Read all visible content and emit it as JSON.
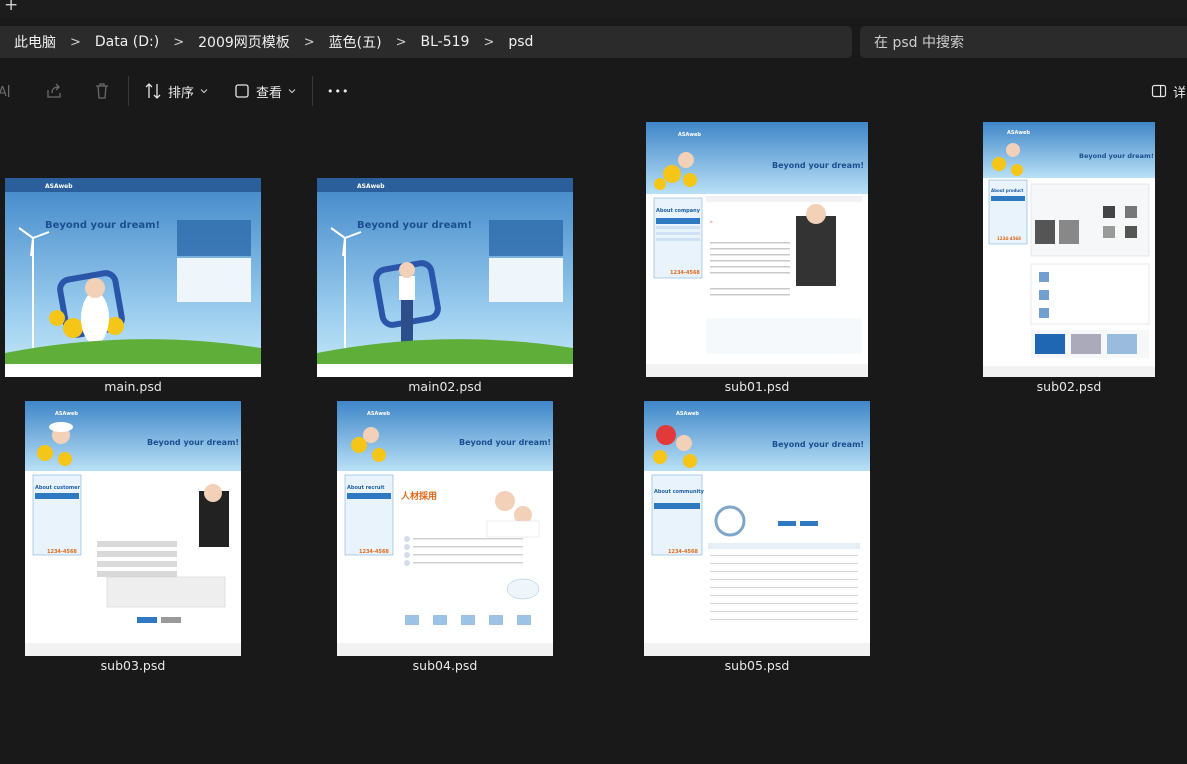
{
  "titlebar": {
    "new_tab_label": "+"
  },
  "breadcrumb": [
    "此电脑",
    "Data (D:)",
    "2009网页模板",
    "蓝色(五)",
    "BL-519",
    "psd"
  ],
  "breadcrumb_separator": ">",
  "search": {
    "placeholder": "在 psd 中搜索"
  },
  "toolbar": {
    "sort_label": "排序",
    "view_label": "查看",
    "more_label": "•••",
    "details_label": "详"
  },
  "files": [
    {
      "name": "main.psd",
      "kind": "main",
      "slogan": "Beyond your dream!"
    },
    {
      "name": "main02.psd",
      "kind": "main",
      "slogan": "Beyond your dream!"
    },
    {
      "name": "sub01.psd",
      "kind": "sub",
      "slogan": "Beyond your dream!",
      "section": "About company"
    },
    {
      "name": "sub02.psd",
      "kind": "sub",
      "slogan": "Beyond your dream!",
      "section": "About product"
    },
    {
      "name": "sub03.psd",
      "kind": "sub",
      "slogan": "Beyond your dream!",
      "section": "About customer"
    },
    {
      "name": "sub04.psd",
      "kind": "sub",
      "slogan": "Beyond your dream!",
      "section": "About recruit"
    },
    {
      "name": "sub05.psd",
      "kind": "sub",
      "slogan": "Beyond your dream!",
      "section": "About community"
    }
  ],
  "colors": {
    "background": "#191919",
    "bar": "#2b2b2b",
    "sky": "#5fa8df",
    "accent": "#f0c419"
  }
}
